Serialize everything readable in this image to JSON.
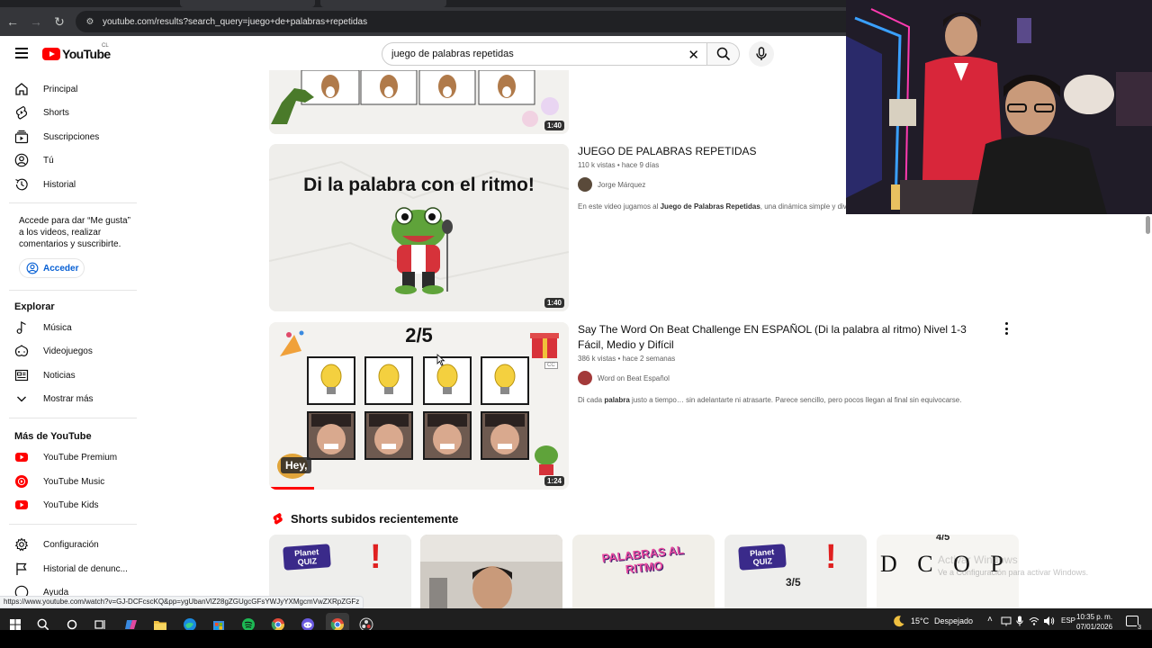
{
  "browser": {
    "url": "youtube.com/results?search_query=juego+de+palabras+repetidas"
  },
  "header": {
    "logo_text": "YouTube",
    "country_code": "CL",
    "search_value": "juego de palabras repetidas"
  },
  "sidebar": {
    "items": [
      {
        "label": "Principal",
        "icon": "home-icon"
      },
      {
        "label": "Shorts",
        "icon": "shorts-icon"
      },
      {
        "label": "Suscripciones",
        "icon": "subscriptions-icon"
      },
      {
        "label": "Tú",
        "icon": "user-icon"
      },
      {
        "label": "Historial",
        "icon": "history-icon"
      }
    ],
    "signin_prompt": "Accede para dar “Me gusta” a los videos, realizar comentarios y suscribirte.",
    "signin_label": "Acceder",
    "explore_heading": "Explorar",
    "explore_items": [
      {
        "label": "Música",
        "icon": "music-icon"
      },
      {
        "label": "Videojuegos",
        "icon": "gaming-icon"
      },
      {
        "label": "Noticias",
        "icon": "news-icon"
      },
      {
        "label": "Mostrar más",
        "icon": "chevron-down-icon"
      }
    ],
    "more_heading": "Más de YouTube",
    "more_items": [
      {
        "label": "YouTube Premium"
      },
      {
        "label": "YouTube Music"
      },
      {
        "label": "YouTube Kids"
      }
    ],
    "settings_items": [
      {
        "label": "Configuración",
        "icon": "gear-icon"
      },
      {
        "label": "Historial de denunc...",
        "icon": "flag-icon"
      },
      {
        "label": "Ayuda",
        "icon": "help-icon"
      }
    ]
  },
  "results": [
    {
      "duration": "1:40"
    },
    {
      "title": "JUEGO DE PALABRAS REPETIDAS",
      "meta": "110 k vistas • hace 9 días",
      "channel": "Jorge Márquez",
      "desc_pre": "En este video jugamos al ",
      "desc_bold": "Juego de Palabras Repetidas",
      "desc_post": ", una dinámica simple y divertida",
      "thumb_text": "Di la palabra con el ritmo!",
      "duration": "1:40"
    },
    {
      "title": "Say The Word On Beat Challenge EN ESPAÑOL (Di la palabra al ritmo) Nivel 1-3 Fácil, Medio y Difícil",
      "meta": "386 k vistas • hace 2 semanas",
      "channel": "Word on Beat Español",
      "desc_pre": "Di cada ",
      "desc_bold": "palabra",
      "desc_post": " justo a tiempo… sin adelantarte ni atrasarte. Parece sencillo, pero pocos llegan al final sin equivocarse.",
      "thumb_counter": "2/5",
      "thumb_caption": "Hey,",
      "cc_badge": "CC",
      "duration": "1:24",
      "watched_fraction": 0.15
    }
  ],
  "shorts": {
    "heading": "Shorts subidos recientemente",
    "items": [
      {
        "label": "Planet QUIZ"
      },
      {
        "label": ""
      },
      {
        "label": "PALABRAS AL RITMO"
      },
      {
        "label": "Planet QUIZ",
        "counter": "3/5"
      },
      {
        "label": "D C O P",
        "counter": "4/5"
      }
    ]
  },
  "status_url": "https://www.youtube.com/watch?v=GJ-DCFcscKQ&pp=ygUbanVlZ28gZGUgcGFsYWJyYXMgcmVwZXRpZGFz",
  "windows_watermark": {
    "line1": "Activar Windows",
    "line2": "Ve a Configuración para activar Windows."
  },
  "taskbar": {
    "temperature": "15°C",
    "weather": "Despejado",
    "language": "ESP",
    "time": "10:35 p. m.",
    "date": "07/01/2026",
    "notifications": "3"
  },
  "colors": {
    "brand_red": "#ff0000",
    "link_blue": "#065fd4",
    "taskbar": "#1f1f1f"
  }
}
